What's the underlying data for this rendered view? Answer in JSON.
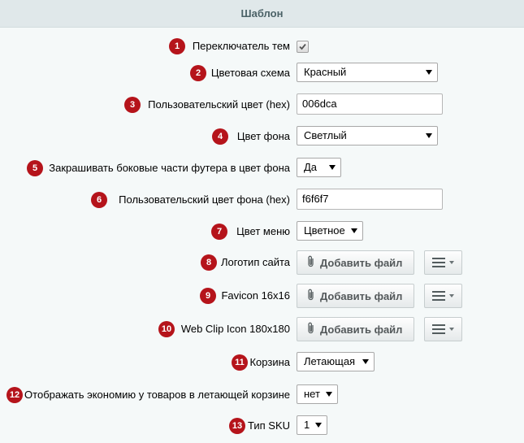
{
  "header": {
    "title": "Шаблон"
  },
  "rows": [
    {
      "num": "1",
      "label": "Переключатель тем",
      "type": "checkbox",
      "checked": true
    },
    {
      "num": "2",
      "label": "Цветовая схема",
      "type": "select",
      "value": "Красный"
    },
    {
      "num": "3",
      "label": "Пользовательский цвет (hex)",
      "type": "input",
      "value": "006dca"
    },
    {
      "num": "4",
      "label": "Цвет фона",
      "type": "select",
      "value": "Светлый"
    },
    {
      "num": "5",
      "label": "Закрашивать боковые части футера в цвет фона",
      "type": "select",
      "value": "Да"
    },
    {
      "num": "6",
      "label": "Пользовательский цвет фона (hex)",
      "type": "input",
      "value": "f6f6f7"
    },
    {
      "num": "7",
      "label": "Цвет меню",
      "type": "select",
      "value": "Цветное"
    },
    {
      "num": "8",
      "label": "Логотип сайта",
      "type": "file",
      "button": "Добавить файл"
    },
    {
      "num": "9",
      "label": "Favicon 16x16",
      "type": "file",
      "button": "Добавить файл"
    },
    {
      "num": "10",
      "label": "Web Clip Icon 180x180",
      "type": "file",
      "button": "Добавить файл"
    },
    {
      "num": "11",
      "label": "Корзина",
      "type": "select",
      "value": "Летающая"
    },
    {
      "num": "12",
      "label": "Отображать экономию у товаров в летающей корзине",
      "type": "select",
      "value": "нет"
    },
    {
      "num": "13",
      "label": "Тип SKU",
      "type": "select",
      "value": "1"
    }
  ],
  "colors": {
    "badge": "#b5141b",
    "header_bg": "#e0e8ea",
    "page_bg": "#f5f9f9"
  },
  "icons": {
    "checkbox": "checkmark-icon",
    "file": "paperclip-icon",
    "menu": "hamburger-icon"
  }
}
